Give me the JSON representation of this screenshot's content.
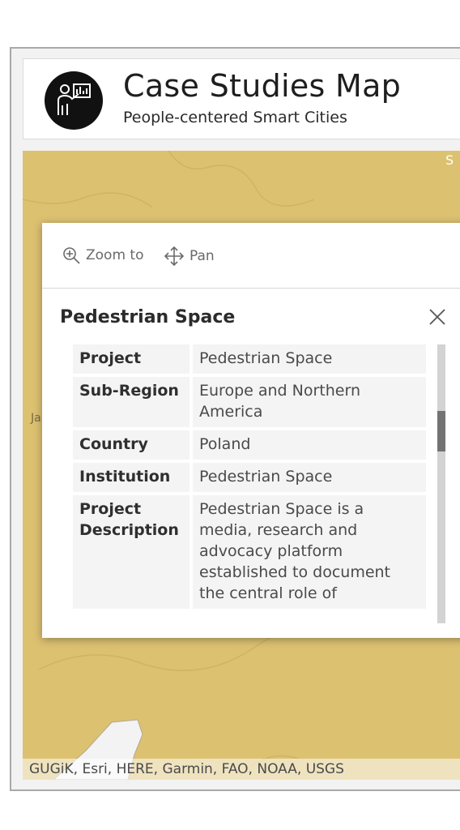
{
  "header": {
    "title": "Case Studies Map",
    "subtitle": "People-centered Smart Cities",
    "logo_icon": "person-presenting-icon"
  },
  "map": {
    "label_left": "Ja",
    "label_top_right": "S",
    "attribution": "GUGiK, Esri, HERE, Garmin, FAO, NOAA, USGS",
    "land_color": "#dcc171"
  },
  "popup": {
    "actions": [
      {
        "label": "Zoom to",
        "icon": "zoom-in-icon"
      },
      {
        "label": "Pan",
        "icon": "pan-arrows-icon"
      }
    ],
    "title": "Pedestrian Space",
    "close_icon": "close-icon",
    "fields": [
      {
        "key": "Project",
        "value": "Pedestrian Space"
      },
      {
        "key": "Sub-Region",
        "value": "Europe and Northern America"
      },
      {
        "key": "Country",
        "value": "Poland"
      },
      {
        "key": "Institution",
        "value": "Pedestrian Space"
      },
      {
        "key": "Project Description",
        "value": "Pedestrian Space is a media, research and advocacy platform established to document the central role of"
      }
    ]
  }
}
